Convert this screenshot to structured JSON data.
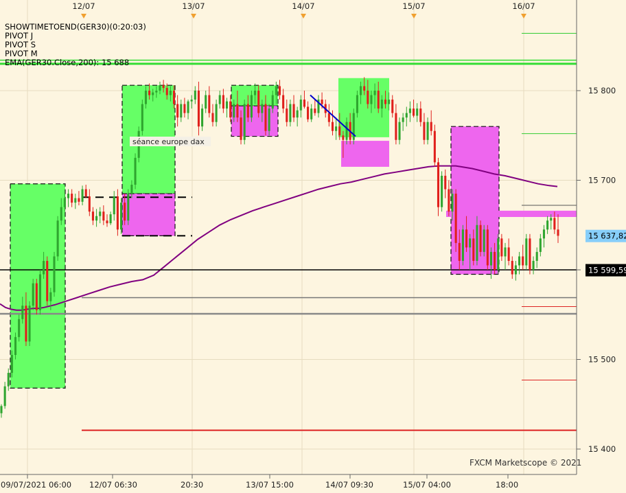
{
  "chart_data": {
    "type": "candlestick",
    "indicators": [
      {
        "text": "SHOWTIMETOEND(GER30)(0:20:03)",
        "color": "#000000"
      },
      {
        "text": "PIVOT J",
        "color": "#000000"
      },
      {
        "text": "PIVOT S",
        "color": "#000000"
      },
      {
        "text": "PIVOT M",
        "color": "#000000"
      },
      {
        "text": "EMA(GER30.Close,200): 15 688",
        "color": "#8b008b"
      }
    ],
    "top_date_labels": [
      "12/07",
      "13/07",
      "14/07",
      "15/07",
      "16/07"
    ],
    "x_tick_labels": [
      "09/07/2021 06:00",
      "12/07 06:30",
      "20:30",
      "13/07 15:00",
      "14/07 09:30",
      "15/07 04:00",
      "18:00"
    ],
    "y_tick_labels": [
      "15 800",
      "15 700",
      "15 600",
      "15 500",
      "15 400"
    ],
    "y_ticks": [
      15800,
      15700,
      15600,
      15500,
      15400
    ],
    "ylim": [
      15394,
      15895
    ],
    "price_labels": [
      {
        "text": "15 637,82",
        "value": 15637.8,
        "bg": "#87cefa",
        "color": "#000000"
      },
      {
        "text": "15 599,59",
        "value": 15599.6,
        "bg": "#000000",
        "color": "#ffffff"
      }
    ],
    "annotation": "séance europe dax",
    "watermark": "FXCM Marketscope © 2021",
    "colors": {
      "up": "#2fa52f",
      "down": "#e0201c",
      "ema": "#800080",
      "green_zone": "#66ff66",
      "pink_zone": "#ee66ee"
    },
    "candles": [
      [
        15440,
        15450,
        15435,
        15448
      ],
      [
        15448,
        15475,
        15445,
        15470
      ],
      [
        15470,
        15490,
        15465,
        15485
      ],
      [
        15485,
        15510,
        15480,
        15505
      ],
      [
        15505,
        15530,
        15500,
        15525
      ],
      [
        15525,
        15550,
        15520,
        15545
      ],
      [
        15545,
        15570,
        15540,
        15560
      ],
      [
        15560,
        15575,
        15515,
        15520
      ],
      [
        15520,
        15565,
        15515,
        15560
      ],
      [
        15560,
        15590,
        15555,
        15585
      ],
      [
        15585,
        15590,
        15550,
        15555
      ],
      [
        15555,
        15600,
        15550,
        15595
      ],
      [
        15595,
        15620,
        15590,
        15610
      ],
      [
        15610,
        15615,
        15560,
        15565
      ],
      [
        15565,
        15580,
        15555,
        15575
      ],
      [
        15575,
        15620,
        15570,
        15615
      ],
      [
        15615,
        15660,
        15610,
        15655
      ],
      [
        15655,
        15680,
        15650,
        15670
      ],
      [
        15670,
        15685,
        15665,
        15680
      ],
      [
        15680,
        15690,
        15670,
        15685
      ],
      [
        15685,
        15690,
        15670,
        15675
      ],
      [
        15675,
        15685,
        15668,
        15680
      ],
      [
        15680,
        15688,
        15672,
        15676
      ],
      [
        15676,
        15694,
        15672,
        15690
      ],
      [
        15690,
        15695,
        15680,
        15682
      ],
      [
        15682,
        15690,
        15660,
        15665
      ],
      [
        15665,
        15670,
        15650,
        15655
      ],
      [
        15655,
        15668,
        15648,
        15660
      ],
      [
        15660,
        15670,
        15652,
        15665
      ],
      [
        15665,
        15672,
        15650,
        15655
      ],
      [
        15655,
        15662,
        15648,
        15652
      ],
      [
        15652,
        15665,
        15650,
        15662
      ],
      [
        15662,
        15688,
        15655,
        15682
      ],
      [
        15682,
        15690,
        15638,
        15645
      ],
      [
        15645,
        15680,
        15640,
        15675
      ],
      [
        15675,
        15685,
        15650,
        15655
      ],
      [
        15655,
        15690,
        15650,
        15685
      ],
      [
        15685,
        15700,
        15680,
        15695
      ],
      [
        15695,
        15730,
        15690,
        15725
      ],
      [
        15725,
        15760,
        15720,
        15755
      ],
      [
        15755,
        15790,
        15750,
        15785
      ],
      [
        15785,
        15805,
        15780,
        15800
      ],
      [
        15800,
        15808,
        15790,
        15795
      ],
      [
        15795,
        15802,
        15788,
        15798
      ],
      [
        15798,
        15805,
        15792,
        15800
      ],
      [
        15800,
        15810,
        15796,
        15806
      ],
      [
        15806,
        15812,
        15798,
        15803
      ],
      [
        15803,
        15808,
        15790,
        15795
      ],
      [
        15795,
        15805,
        15788,
        15800
      ],
      [
        15800,
        15806,
        15780,
        15785
      ],
      [
        15785,
        15795,
        15760,
        15770
      ],
      [
        15770,
        15790,
        15765,
        15785
      ],
      [
        15785,
        15792,
        15770,
        15775
      ],
      [
        15775,
        15790,
        15768,
        15788
      ],
      [
        15788,
        15795,
        15780,
        15790
      ],
      [
        15790,
        15805,
        15785,
        15800
      ],
      [
        15800,
        15810,
        15750,
        15760
      ],
      [
        15760,
        15785,
        15755,
        15780
      ],
      [
        15780,
        15800,
        15775,
        15795
      ],
      [
        15795,
        15805,
        15770,
        15775
      ],
      [
        15775,
        15785,
        15760,
        15765
      ],
      [
        15765,
        15790,
        15760,
        15785
      ],
      [
        15785,
        15800,
        15780,
        15795
      ],
      [
        15795,
        15802,
        15775,
        15780
      ],
      [
        15780,
        15792,
        15770,
        15788
      ],
      [
        15788,
        15795,
        15765,
        15770
      ],
      [
        15770,
        15790,
        15765,
        15785
      ],
      [
        15785,
        15800,
        15765,
        15770
      ],
      [
        15770,
        15778,
        15740,
        15745
      ],
      [
        15745,
        15790,
        15740,
        15785
      ],
      [
        15785,
        15795,
        15765,
        15770
      ],
      [
        15770,
        15800,
        15765,
        15795
      ],
      [
        15795,
        15808,
        15785,
        15800
      ],
      [
        15800,
        15806,
        15770,
        15775
      ],
      [
        15775,
        15790,
        15765,
        15785
      ],
      [
        15785,
        15795,
        15750,
        15755
      ],
      [
        15755,
        15785,
        15750,
        15780
      ],
      [
        15780,
        15800,
        15775,
        15795
      ],
      [
        15795,
        15810,
        15785,
        15805
      ],
      [
        15805,
        15812,
        15790,
        15795
      ],
      [
        15795,
        15802,
        15775,
        15780
      ],
      [
        15780,
        15790,
        15760,
        15765
      ],
      [
        15765,
        15790,
        15760,
        15785
      ],
      [
        15785,
        15795,
        15765,
        15770
      ],
      [
        15770,
        15782,
        15760,
        15778
      ],
      [
        15778,
        15795,
        15770,
        15790
      ],
      [
        15790,
        15800,
        15780,
        15782
      ],
      [
        15782,
        15788,
        15765,
        15768
      ],
      [
        15768,
        15785,
        15765,
        15780
      ],
      [
        15780,
        15790,
        15772,
        15775
      ],
      [
        15775,
        15795,
        15770,
        15790
      ],
      [
        15790,
        15798,
        15780,
        15785
      ],
      [
        15785,
        15790,
        15770,
        15775
      ],
      [
        15775,
        15785,
        15760,
        15765
      ],
      [
        15765,
        15778,
        15750,
        15755
      ],
      [
        15755,
        15770,
        15745,
        15760
      ],
      [
        15760,
        15775,
        15745,
        15750
      ],
      [
        15750,
        15755,
        15725,
        15745
      ],
      [
        15745,
        15770,
        15740,
        15765
      ],
      [
        15765,
        15775,
        15740,
        15745
      ],
      [
        15745,
        15780,
        15740,
        15775
      ],
      [
        15775,
        15800,
        15770,
        15795
      ],
      [
        15795,
        15810,
        15785,
        15805
      ],
      [
        15805,
        15815,
        15795,
        15800
      ],
      [
        15800,
        15812,
        15780,
        15785
      ],
      [
        15785,
        15800,
        15775,
        15795
      ],
      [
        15795,
        15808,
        15780,
        15800
      ],
      [
        15800,
        15810,
        15775,
        15780
      ],
      [
        15780,
        15795,
        15770,
        15790
      ],
      [
        15790,
        15800,
        15780,
        15785
      ],
      [
        15785,
        15798,
        15778,
        15790
      ],
      [
        15790,
        15795,
        15770,
        15775
      ],
      [
        15775,
        15785,
        15740,
        15745
      ],
      [
        15745,
        15770,
        15740,
        15765
      ],
      [
        15765,
        15775,
        15755,
        15770
      ],
      [
        15770,
        15782,
        15760,
        15775
      ],
      [
        15775,
        15788,
        15765,
        15780
      ],
      [
        15780,
        15790,
        15770,
        15772
      ],
      [
        15772,
        15786,
        15765,
        15780
      ],
      [
        15780,
        15788,
        15760,
        15765
      ],
      [
        15765,
        15775,
        15740,
        15745
      ],
      [
        15745,
        15770,
        15740,
        15765
      ],
      [
        15765,
        15778,
        15750,
        15755
      ],
      [
        15755,
        15762,
        15715,
        15720
      ],
      [
        15720,
        15725,
        15660,
        15670
      ],
      [
        15670,
        15710,
        15665,
        15705
      ],
      [
        15705,
        15712,
        15680,
        15690
      ],
      [
        15690,
        15700,
        15660,
        15665
      ],
      [
        15665,
        15690,
        15655,
        15685
      ],
      [
        15685,
        15690,
        15620,
        15630
      ],
      [
        15630,
        15645,
        15600,
        15610
      ],
      [
        15610,
        15650,
        15605,
        15645
      ],
      [
        15645,
        15660,
        15620,
        15625
      ],
      [
        15625,
        15640,
        15600,
        15635
      ],
      [
        15635,
        15645,
        15605,
        15610
      ],
      [
        15610,
        15660,
        15605,
        15650
      ],
      [
        15650,
        15655,
        15615,
        15620
      ],
      [
        15620,
        15650,
        15615,
        15645
      ],
      [
        15645,
        15650,
        15600,
        15605
      ],
      [
        15605,
        15625,
        15590,
        15620
      ],
      [
        15620,
        15630,
        15595,
        15600
      ],
      [
        15600,
        15640,
        15595,
        15635
      ],
      [
        15635,
        15640,
        15610,
        15615
      ],
      [
        15615,
        15630,
        15600,
        15625
      ],
      [
        15625,
        15635,
        15605,
        15610
      ],
      [
        15610,
        15615,
        15590,
        15595
      ],
      [
        15595,
        15610,
        15588,
        15605
      ],
      [
        15605,
        15620,
        15595,
        15615
      ],
      [
        15615,
        15628,
        15600,
        15605
      ],
      [
        15605,
        15640,
        15600,
        15635
      ],
      [
        15635,
        15640,
        15595,
        15600
      ],
      [
        15600,
        15615,
        15595,
        15610
      ],
      [
        15610,
        15625,
        15602,
        15620
      ],
      [
        15620,
        15640,
        15615,
        15635
      ],
      [
        15635,
        15650,
        15625,
        15645
      ],
      [
        15645,
        15660,
        15640,
        15655
      ],
      [
        15655,
        15662,
        15645,
        15658
      ],
      [
        15658,
        15665,
        15640,
        15645
      ],
      [
        15645,
        15662,
        15630,
        15638
      ]
    ],
    "ema": [
      [
        0,
        15562
      ],
      [
        8,
        15558
      ],
      [
        16,
        15556
      ],
      [
        24,
        15555
      ],
      [
        32,
        15555
      ],
      [
        40,
        15556
      ],
      [
        48,
        15557
      ],
      [
        56,
        15557
      ],
      [
        64,
        15558
      ],
      [
        80,
        15561
      ],
      [
        96,
        15565
      ],
      [
        112,
        15569
      ],
      [
        128,
        15573
      ],
      [
        144,
        15577
      ],
      [
        160,
        15581
      ],
      [
        176,
        15584
      ],
      [
        192,
        15587
      ],
      [
        208,
        15589
      ],
      [
        224,
        15594
      ],
      [
        240,
        15604
      ],
      [
        256,
        15614
      ],
      [
        272,
        15624
      ],
      [
        288,
        15634
      ],
      [
        304,
        15642
      ],
      [
        320,
        15650
      ],
      [
        336,
        15656
      ],
      [
        352,
        15661
      ],
      [
        368,
        15666
      ],
      [
        384,
        15670
      ],
      [
        400,
        15674
      ],
      [
        416,
        15678
      ],
      [
        432,
        15682
      ],
      [
        448,
        15686
      ],
      [
        464,
        15690
      ],
      [
        480,
        15693
      ],
      [
        496,
        15696
      ],
      [
        512,
        15698
      ],
      [
        528,
        15701
      ],
      [
        544,
        15704
      ],
      [
        560,
        15707
      ],
      [
        576,
        15709
      ],
      [
        592,
        15711
      ],
      [
        608,
        15713
      ],
      [
        624,
        15715
      ],
      [
        640,
        15716
      ],
      [
        656,
        15716
      ],
      [
        664,
        15716
      ],
      [
        672,
        15715
      ],
      [
        688,
        15713
      ],
      [
        704,
        15710
      ],
      [
        720,
        15707
      ],
      [
        736,
        15705
      ],
      [
        752,
        15702
      ],
      [
        768,
        15699
      ],
      [
        784,
        15696
      ],
      [
        800,
        15694
      ],
      [
        812,
        15693
      ]
    ],
    "zones": [
      {
        "type": "green",
        "x1": 15,
        "x2": 95,
        "y1": 15696,
        "y2": 15468,
        "dashed": true
      },
      {
        "type": "green",
        "x1": 178,
        "x2": 255,
        "y1": 15806,
        "y2": 15685,
        "dashed": true
      },
      {
        "type": "pink",
        "x1": 178,
        "x2": 255,
        "y1": 15685,
        "y2": 15638,
        "dashed": true
      },
      {
        "type": "green",
        "x1": 337,
        "x2": 405,
        "y1": 15806,
        "y2": 15783,
        "dashed": true
      },
      {
        "type": "pink",
        "x1": 337,
        "x2": 405,
        "y1": 15783,
        "y2": 15749,
        "dashed": true
      },
      {
        "type": "green",
        "x1": 493,
        "x2": 567,
        "y1": 15814,
        "y2": 15748,
        "dashed": false
      },
      {
        "type": "pink",
        "x1": 497,
        "x2": 567,
        "y1": 15744,
        "y2": 15715,
        "dashed": false
      },
      {
        "type": "pink",
        "x1": 657,
        "x2": 727,
        "y1": 15760,
        "y2": 15595,
        "dashed": true
      },
      {
        "type": "pink",
        "x1": 650,
        "x2": 840,
        "y1": 15666,
        "y2": 15659,
        "dashed": false
      }
    ],
    "hlines": [
      {
        "value": 15830,
        "x1": 0,
        "x2": 840,
        "color": "#33dd33",
        "width": 3
      },
      {
        "value": 15834,
        "x1": 0,
        "x2": 840,
        "color": "#33dd33",
        "width": 1.5
      },
      {
        "value": 15864,
        "x1": 760,
        "x2": 840,
        "color": "#33cc33",
        "width": 1
      },
      {
        "value": 15752,
        "x1": 760,
        "x2": 840,
        "color": "#33cc33",
        "width": 1
      },
      {
        "value": 15672,
        "x1": 760,
        "x2": 840,
        "color": "#555555",
        "width": 1
      },
      {
        "value": 15600,
        "x1": 0,
        "x2": 840,
        "color": "#000000",
        "width": 1.5
      },
      {
        "value": 15569,
        "x1": 119,
        "x2": 840,
        "color": "#777777",
        "width": 1.5
      },
      {
        "value": 15551,
        "x1": 0,
        "x2": 840,
        "color": "#888888",
        "width": 2.5
      },
      {
        "value": 15559,
        "x1": 760,
        "x2": 840,
        "color": "#dd2222",
        "width": 1
      },
      {
        "value": 15477,
        "x1": 760,
        "x2": 840,
        "color": "#dd2222",
        "width": 1
      },
      {
        "value": 15421,
        "x1": 119,
        "x2": 840,
        "color": "#dd2222",
        "width": 2
      },
      {
        "value": 15681,
        "x1": 119,
        "x2": 280,
        "color": "#000000",
        "width": 2,
        "dash": "12,8"
      },
      {
        "value": 15638,
        "x1": 178,
        "x2": 280,
        "color": "#000000",
        "width": 2,
        "dash": "12,8"
      }
    ],
    "trendline": {
      "x1": 452,
      "y1": 15795,
      "x2": 518,
      "y2": 15749,
      "color": "#0000cc"
    }
  }
}
